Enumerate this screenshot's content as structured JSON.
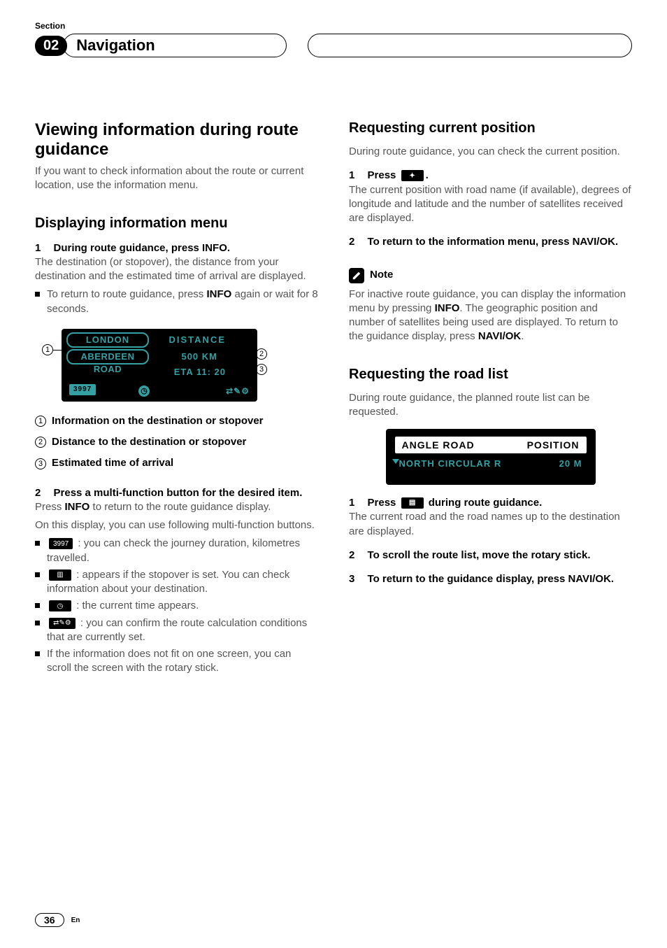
{
  "section_label": "Section",
  "section_number": "02",
  "chapter_title": "Navigation",
  "left": {
    "h2": "Viewing information during route guidance",
    "intro": "If you want to check information about the route or current location, use the information menu.",
    "h3_1": "Displaying information menu",
    "step1_num": "1",
    "step1_title": "During route guidance, press INFO.",
    "step1_body": "The destination (or stopover), the distance from your destination and the estimated time of arrival are displayed.",
    "bullet1_a": "To return to route guidance, press ",
    "bullet1_bold": "INFO",
    "bullet1_b": " again or wait for 8 seconds.",
    "screen1": {
      "london": "LONDON",
      "aberdeen": "ABERDEEN ROAD",
      "distance_label": "DISTANCE",
      "distance_value": "500 KM",
      "eta": "ETA  11: 20",
      "chip": "3997",
      "clock": "◷",
      "br": "⇄✎⚙"
    },
    "legend1_num": "1",
    "legend1": "Information on the destination or stopover",
    "legend2_num": "2",
    "legend2": "Distance to the destination or stopover",
    "legend3_num": "3",
    "legend3": "Estimated time of arrival",
    "step2_num": "2",
    "step2_title": "Press a multi-function button for the desired item.",
    "step2_body_a": "Press ",
    "step2_body_bold": "INFO",
    "step2_body_b": " to return to the route guidance display.",
    "step2_body_c": "On this display, you can use following multi-function buttons.",
    "mb1_icon": "3997",
    "mb1_text": ": you can check the journey duration, kilometres travelled.",
    "mb2_icon": "▥",
    "mb2_text": ": appears if the stopover is set. You can check information about your destination.",
    "mb3_icon": "◷",
    "mb3_text": ": the current time appears.",
    "mb4_icon": "⇄✎⚙",
    "mb4_text": ": you can confirm the route calculation conditions that are currently set.",
    "mb5_text": "If the information does not fit on one screen, you can scroll the screen with the rotary stick."
  },
  "right": {
    "h3_1": "Requesting current position",
    "p1": "During route guidance, you can check the current position.",
    "step1_num": "1",
    "step1_a": "Press ",
    "step1_icon": "✦",
    "step1_b": ".",
    "step1_body": "The current position with road name (if available), degrees of longitude and latitude and the number of satellites received are displayed.",
    "step2_num": "2",
    "step2_title": "To return to the information menu, press NAVI/OK.",
    "note_label": "Note",
    "note_body_a": "For inactive route guidance, you can display the information menu by pressing ",
    "note_bold1": "INFO",
    "note_body_b": ". The geographic position and number of satellites being used are displayed. To return to the guidance display, press ",
    "note_bold2": "NAVI/OK",
    "note_body_c": ".",
    "h3_2": "Requesting the road list",
    "p2": "During route guidance, the planned route list can be requested.",
    "screen2": {
      "left": "ANGLE ROAD",
      "right": "POSITION",
      "row2_left": "NORTH CIRCULAR R",
      "row2_right": "20 M"
    },
    "rl_step1_num": "1",
    "rl_step1_a": "Press ",
    "rl_step1_icon": "▤",
    "rl_step1_b": " during route guidance.",
    "rl_step1_body": "The current road and the road names up to the destination are displayed.",
    "rl_step2_num": "2",
    "rl_step2_title": "To scroll the route list, move the rotary stick.",
    "rl_step3_num": "3",
    "rl_step3_title": "To return to the guidance display, press NAVI/OK."
  },
  "page_number": "36",
  "lang": "En"
}
